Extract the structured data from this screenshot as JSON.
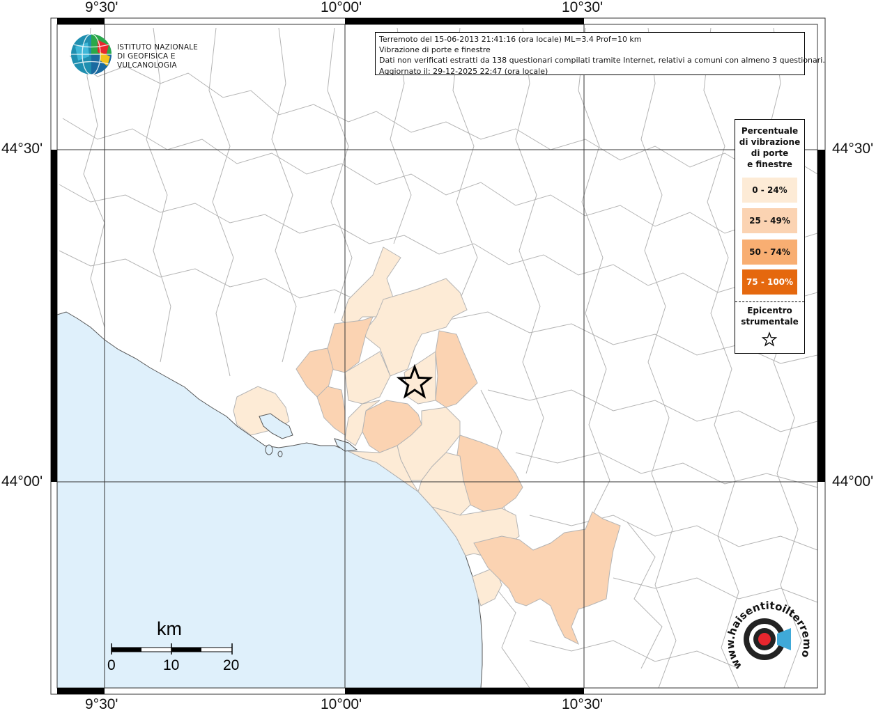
{
  "graticule": {
    "lon_top": [
      "9°30'",
      "10°00'",
      "10°30'"
    ],
    "lon_bottom": [
      "9°30'",
      "10°00'",
      "10°30'"
    ],
    "lat_left": [
      "44°30'",
      "44°00'"
    ],
    "lat_right": [
      "44°30'",
      "44°00'"
    ]
  },
  "logo": {
    "line1": "ISTITUTO NAZIONALE",
    "line2": "DI GEOFISICA E VULCANOLOGIA"
  },
  "info": {
    "line1": "Terremoto del 15-06-2013 21:41:16 (ora locale) ML=3.4 Prof=10 km",
    "line2": "Vibrazione di porte e finestre",
    "line3": "Dati non verificati estratti da 138 questionari compilati tramite Internet, relativi a comuni con almeno 3 questionari.",
    "line4": "Aggiornato il: 29-12-2025 22:47 (ora locale)"
  },
  "legend": {
    "title_lines": [
      "Percentuale",
      "di vibrazione",
      "di porte",
      "e finestre"
    ],
    "classes": [
      {
        "label": "0 - 24%",
        "color": "#fdebd6"
      },
      {
        "label": "25 - 49%",
        "color": "#fbd3b2"
      },
      {
        "label": "50 - 74%",
        "color": "#f8ae72"
      },
      {
        "label": "75 - 100%",
        "color": "#e5680e"
      }
    ],
    "epicenter_lines": [
      "Epicentro",
      "strumentale"
    ]
  },
  "scale": {
    "unit": "km",
    "ticks": [
      "0",
      "10",
      "20"
    ]
  },
  "watermark": {
    "text": "www.haisentitoilterremoto.it"
  },
  "colors": {
    "sea": "#dff0fb",
    "land": "#ffffff",
    "boundaries": "#b4b4b4",
    "grid": "#333333"
  }
}
